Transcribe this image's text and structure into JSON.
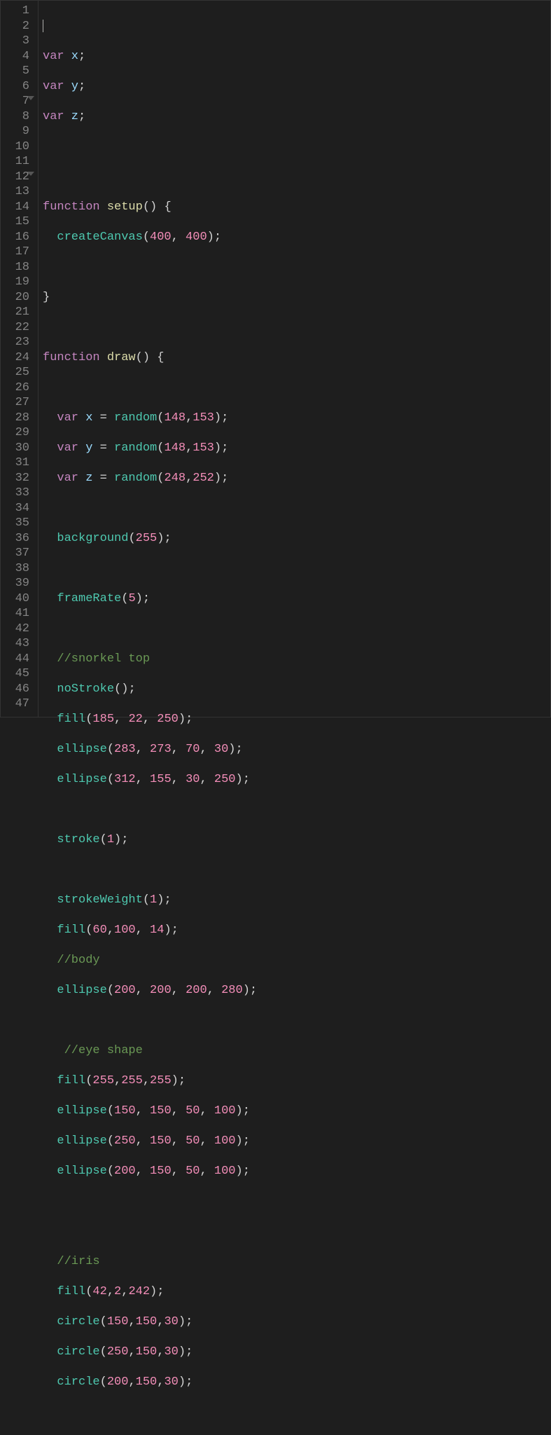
{
  "gutter": {
    "lines": [
      "1",
      "2",
      "3",
      "4",
      "5",
      "6",
      "7",
      "8",
      "9",
      "10",
      "11",
      "12",
      "13",
      "14",
      "15",
      "16",
      "17",
      "18",
      "19",
      "20",
      "21",
      "22",
      "23",
      "24",
      "25",
      "26",
      "27",
      "28",
      "29",
      "30",
      "31",
      "32",
      "33",
      "34",
      "35",
      "36",
      "37",
      "38",
      "39",
      "40",
      "41",
      "42",
      "43",
      "44",
      "45",
      "46",
      "47"
    ],
    "foldable": [
      7,
      12
    ]
  },
  "code": {
    "tokens": {
      "var_kw": "var",
      "function_kw": "function",
      "eq": " = ",
      "semi": ";",
      "lp": "(",
      "rp": ")",
      "lb": " {",
      "rb": "}",
      "comma": ",",
      "commasp": ", "
    },
    "lines": {
      "l2_name": " x",
      "l3_name": " y",
      "l4_name": " z",
      "l7_fn": " setup",
      "l8_call": "createCanvas",
      "l8_a1": "400",
      "l8_a2": "400",
      "l12_fn": " draw",
      "l14_name": " x",
      "l14_call": "random",
      "l14_a1": "148",
      "l14_a2": "153",
      "l15_name": " y",
      "l15_call": "random",
      "l15_a1": "148",
      "l15_a2": "153",
      "l16_name": " z",
      "l16_call": "random",
      "l16_a1": "248",
      "l16_a2": "252",
      "l18_call": "background",
      "l18_a1": "255",
      "l20_call": "frameRate",
      "l20_a1": "5",
      "l22_comment": "//snorkel top",
      "l23_call": "noStroke",
      "l24_call": "fill",
      "l24_a1": "185",
      "l24_a2": "22",
      "l24_a3": "250",
      "l25_call": "ellipse",
      "l25_a1": "283",
      "l25_a2": "273",
      "l25_a3": "70",
      "l25_a4": "30",
      "l26_call": "ellipse",
      "l26_a1": "312",
      "l26_a2": "155",
      "l26_a3": "30",
      "l26_a4": "250",
      "l28_call": "stroke",
      "l28_a1": "1",
      "l30_call": "strokeWeight",
      "l30_a1": "1",
      "l31_call": "fill",
      "l31_a1": "60",
      "l31_a2": "100",
      "l31_a3": "14",
      "l32_comment": "//body",
      "l33_call": "ellipse",
      "l33_a1": "200",
      "l33_a2": "200",
      "l33_a3": "200",
      "l33_a4": "280",
      "l35_comment": " //eye shape",
      "l36_call": "fill",
      "l36_a1": "255",
      "l36_a2": "255",
      "l36_a3": "255",
      "l37_call": "ellipse",
      "l37_a1": "150",
      "l37_a2": "150",
      "l37_a3": "50",
      "l37_a4": "100",
      "l38_call": "ellipse",
      "l38_a1": "250",
      "l38_a2": "150",
      "l38_a3": "50",
      "l38_a4": "100",
      "l39_call": "ellipse",
      "l39_a1": "200",
      "l39_a2": "150",
      "l39_a3": "50",
      "l39_a4": "100",
      "l42_comment": "//iris",
      "l43_call": "fill",
      "l43_a1": "42",
      "l43_a2": "2",
      "l43_a3": "242",
      "l44_call": "circle",
      "l44_a1": "150",
      "l44_a2": "150",
      "l44_a3": "30",
      "l45_call": "circle",
      "l45_a1": "250",
      "l45_a2": "150",
      "l45_a3": "30",
      "l46_call": "circle",
      "l46_a1": "200",
      "l46_a2": "150",
      "l46_a3": "30"
    }
  }
}
